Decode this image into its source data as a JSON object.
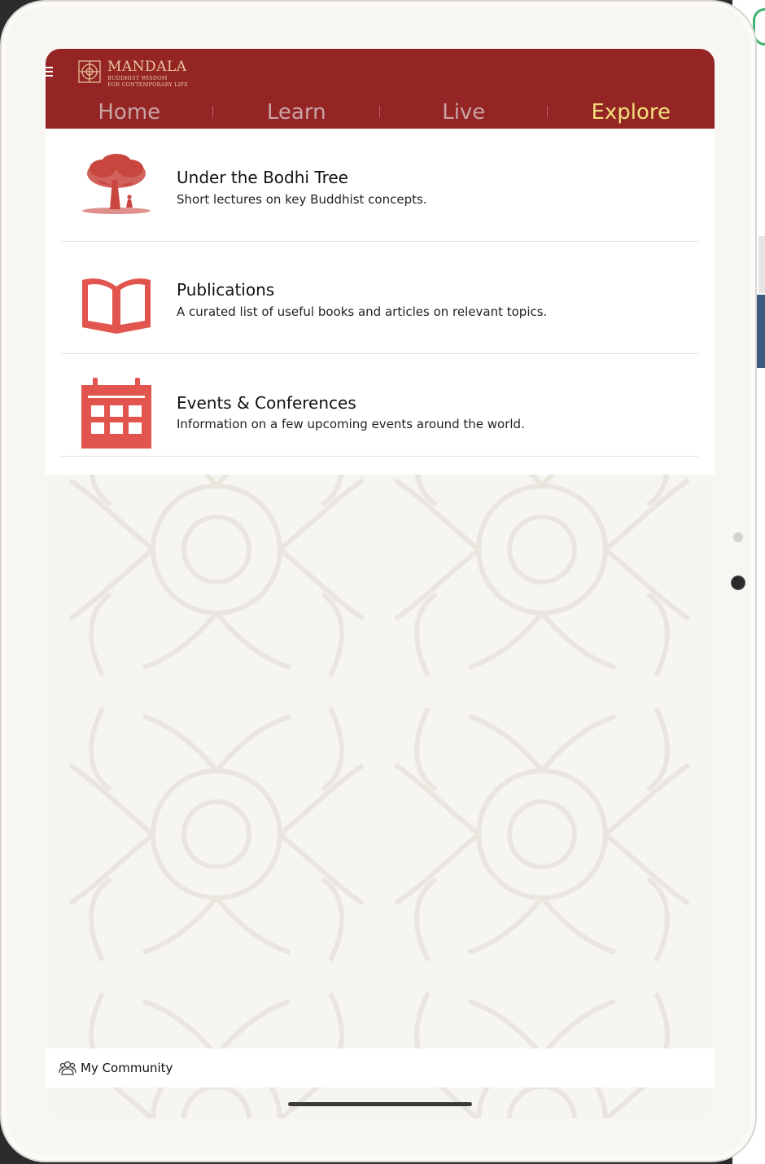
{
  "app": {
    "logo_title": "MANDALA",
    "logo_subtitle_1": "BUDDHIST WISDOM",
    "logo_subtitle_2": "FOR CONTEMPORARY LIFE"
  },
  "nav": {
    "tabs": [
      {
        "label": "Home",
        "active": false
      },
      {
        "label": "Learn",
        "active": false
      },
      {
        "label": "Live",
        "active": false
      },
      {
        "label": "Explore",
        "active": true
      }
    ]
  },
  "items": [
    {
      "title": "Under the Bodhi Tree",
      "description": "Short lectures on key Buddhist concepts.",
      "icon": "bodhi-tree-icon"
    },
    {
      "title": "Publications",
      "description": "A curated list of useful books and articles on relevant topics.",
      "icon": "book-icon"
    },
    {
      "title": "Events & Conferences",
      "description": "Information on a few upcoming events around the world.",
      "icon": "calendar-icon"
    }
  ],
  "footer": {
    "community_label": "My Community",
    "icon": "people-icon"
  },
  "colors": {
    "header": "#952525",
    "active_tab": "#f1e07a",
    "inactive_tab": "#c9a4a4",
    "accent_icon": "#e2554e"
  }
}
